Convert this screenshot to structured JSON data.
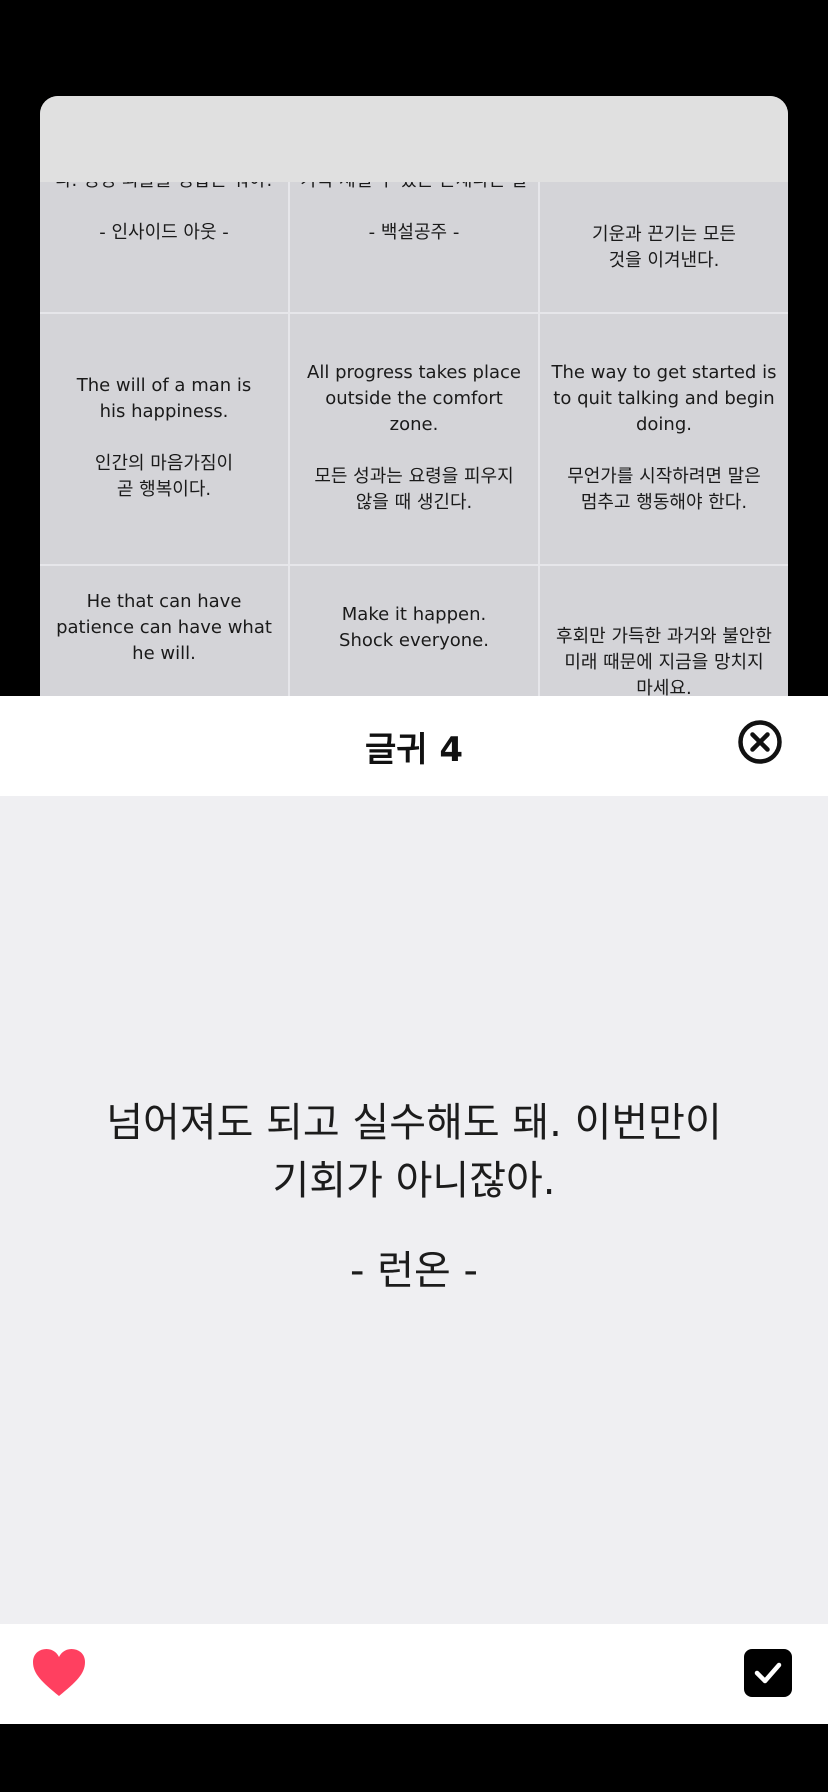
{
  "grid": {
    "cells": [
      {
        "text": "다. 영영 외들을 영합은 뭐야!\n\n- 인사이드 아웃 -"
      },
      {
        "text": "가족 세일 우 있는 존재다는 말\n\n- 백설공주 -"
      },
      {
        "text": "기운과 끈기는 모든\n것을 이겨낸다."
      },
      {
        "text": "The will of a man is\nhis happiness.\n\n인간의 마음가짐이\n곧 행복이다."
      },
      {
        "text": "All progress takes place\noutside the comfort\nzone.\n\n모든 성과는 요령을 피우지\n않을 때 생긴다."
      },
      {
        "text": "The way to get started is\nto quit talking and begin\ndoing.\n\n무언가를 시작하려면 말은\n멈추고 행동해야 한다."
      },
      {
        "text": "He that can have\npatience can have what\nhe will."
      },
      {
        "text": "Make it happen.\nShock everyone."
      },
      {
        "text": "후회만 가득한 과거와 불안한\n미래 때문에 지금을 망치지\n마세요."
      }
    ]
  },
  "sheet": {
    "title": "글귀 4",
    "quote_line1": "넘어져도 되고 실수해도 돼. 이번만이",
    "quote_line2": "기회가 아니잖아.",
    "author": "- 런온 -"
  },
  "icons": {
    "close": "close-circle-icon",
    "like": "heart-icon",
    "confirm": "checkbox-checked-icon"
  },
  "colors": {
    "heart": "#ff4060",
    "sheet_background": "#efeff2",
    "card_background": "#d4d4d8"
  }
}
